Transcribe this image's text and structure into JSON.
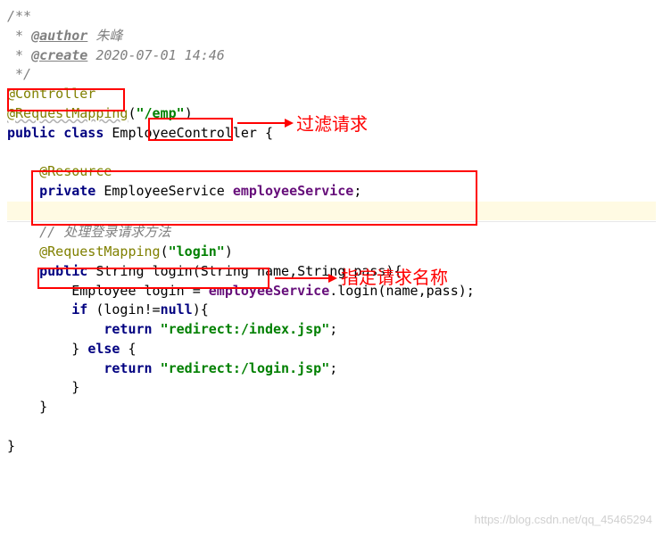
{
  "javadoc": {
    "open": "/**",
    "author_tag": "@author",
    "author_value": "朱峰",
    "create_tag": "@create",
    "create_value": "2020-07-01 14:46",
    "close": "*/",
    "star": " * "
  },
  "code": {
    "controller": "@Controller",
    "requestMapping": "@RequestMapping",
    "emp_path": "\"/emp\"",
    "lp": "(",
    "rp": ")",
    "public": "public",
    "class": "class",
    "className": "EmployeeController",
    "lbrace": " {",
    "resource": "@Resource",
    "private": "private",
    "serviceType": "EmployeeService",
    "serviceField": "employeeService",
    "semi": ";",
    "lineComment": "// 处理登录请求方法",
    "login_str": "\"login\"",
    "stringType": "String",
    "loginMethod": "login",
    "paramsOpen": "(String name,String pass){",
    "empType": "Employee",
    "loginVar": "login",
    "eq": " = ",
    "dot": ".",
    "callArgs": "(name,pass);",
    "if": "if",
    "ifCond": " (login!=",
    "null": "null",
    "ifEnd": "){",
    "return": "return",
    "redirect_index": "\"redirect:/index.jsp\"",
    "rbrace": "}",
    "else": "else",
    "elseBrace": " {",
    "redirect_login": "\"redirect:/login.jsp\""
  },
  "annotations": {
    "label1": "过滤请求",
    "label2": "指定请求名称"
  },
  "watermark": "https://blog.csdn.net/qq_45465294"
}
